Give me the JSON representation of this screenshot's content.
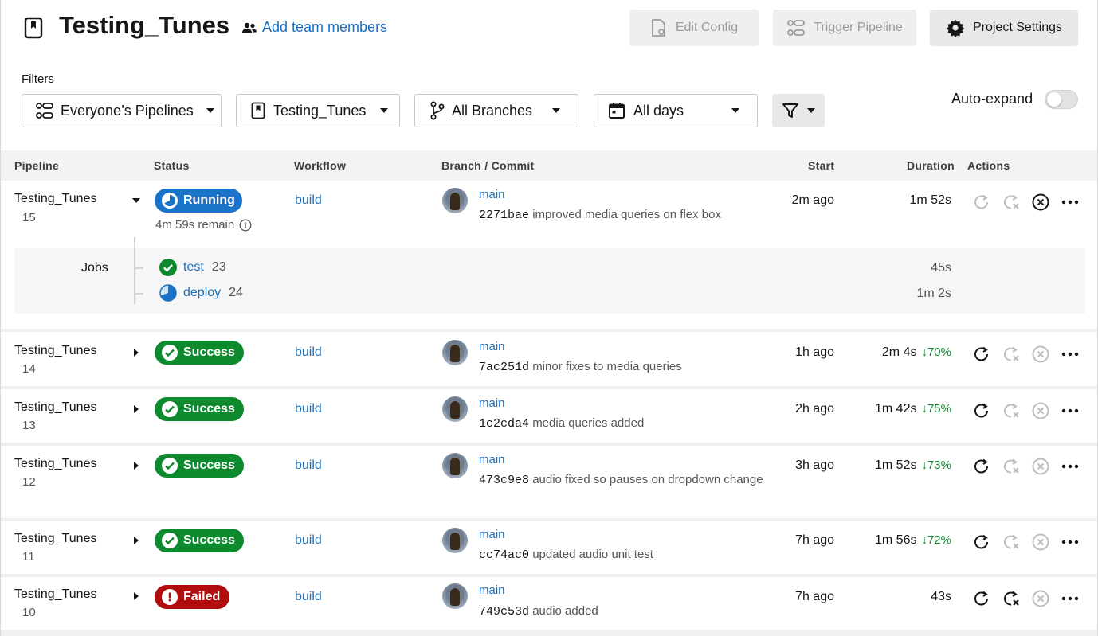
{
  "header": {
    "project_title": "Testing_Tunes",
    "add_team_label": "Add team members",
    "edit_config_label": "Edit Config",
    "trigger_pipeline_label": "Trigger Pipeline",
    "project_settings_label": "Project Settings"
  },
  "filters": {
    "label": "Filters",
    "pipelines": "Everyone’s Pipelines",
    "project": "Testing_Tunes",
    "branches": "All Branches",
    "days": "All days",
    "auto_expand_label": "Auto-expand",
    "auto_expand_on": false
  },
  "table": {
    "columns": [
      "Pipeline",
      "Status",
      "Workflow",
      "Branch / Commit",
      "Start",
      "Duration",
      "Actions"
    ]
  },
  "pipelines": [
    {
      "name": "Testing_Tunes",
      "number": "15",
      "status": "Running",
      "remain": "4m 59s remain",
      "workflow": "build",
      "branch": "main",
      "hash": "2271bae",
      "message": "improved media queries on flex box",
      "start": "2m ago",
      "duration": "1m 52s",
      "pct": ""
    },
    {
      "name": "Testing_Tunes",
      "number": "14",
      "status": "Success",
      "workflow": "build",
      "branch": "main",
      "hash": "7ac251d",
      "message": "minor fixes to media queries",
      "start": "1h ago",
      "duration": "2m 4s",
      "pct": "70%"
    },
    {
      "name": "Testing_Tunes",
      "number": "13",
      "status": "Success",
      "workflow": "build",
      "branch": "main",
      "hash": "1c2cda4",
      "message": "media queries added",
      "start": "2h ago",
      "duration": "1m 42s",
      "pct": "75%"
    },
    {
      "name": "Testing_Tunes",
      "number": "12",
      "status": "Success",
      "workflow": "build",
      "branch": "main",
      "hash": "473c9e8",
      "message": "audio fixed so pauses on dropdown change",
      "start": "3h ago",
      "duration": "1m 52s",
      "pct": "73%"
    },
    {
      "name": "Testing_Tunes",
      "number": "11",
      "status": "Success",
      "workflow": "build",
      "branch": "main",
      "hash": "cc74ac0",
      "message": "updated audio unit test",
      "start": "7h ago",
      "duration": "1m 56s",
      "pct": "72%"
    },
    {
      "name": "Testing_Tunes",
      "number": "10",
      "status": "Failed",
      "workflow": "build",
      "branch": "main",
      "hash": "749c53d",
      "message": "audio added",
      "start": "7h ago",
      "duration": "43s",
      "pct": ""
    }
  ],
  "jobs": {
    "label": "Jobs",
    "items": [
      {
        "name": "test",
        "number": "23",
        "duration": "45s",
        "status": "success"
      },
      {
        "name": "deploy",
        "number": "24",
        "duration": "1m 2s",
        "status": "running"
      }
    ]
  },
  "colors": {
    "success": "#0e8a2e",
    "running": "#1a73c8",
    "failed": "#b00e0e",
    "link": "#1a6fc0"
  }
}
